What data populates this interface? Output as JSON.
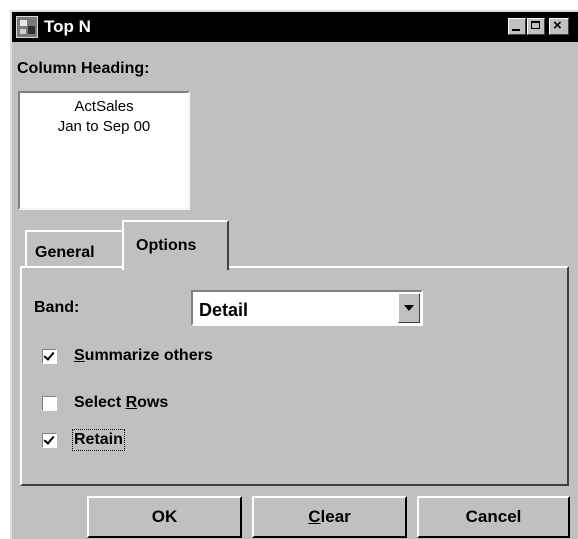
{
  "window": {
    "title": "Top N"
  },
  "column_heading": {
    "label": "Column Heading:",
    "line1": "ActSales",
    "line2": "Jan to Sep 00"
  },
  "tabs": [
    {
      "label": "General",
      "active": false
    },
    {
      "label": "Options",
      "active": true
    }
  ],
  "options": {
    "band_label": "Band:",
    "band_value": "Detail",
    "summarize_pre": "",
    "summarize_key": "S",
    "summarize_post": "ummarize others",
    "summarize_checked": true,
    "select_pre": "Select ",
    "select_key": "R",
    "select_post": "ows",
    "select_checked": false,
    "retain_label": "Retain",
    "retain_checked": true
  },
  "buttons": {
    "ok": "OK",
    "clear_key": "C",
    "clear_rest": "lear",
    "cancel": "Cancel"
  },
  "icons": {
    "app": "app-icon",
    "minimize": "minimize-icon",
    "maximize": "maximize-icon",
    "close": "close-icon",
    "dropdown": "chevron-down-icon",
    "check": "checkmark-icon"
  }
}
